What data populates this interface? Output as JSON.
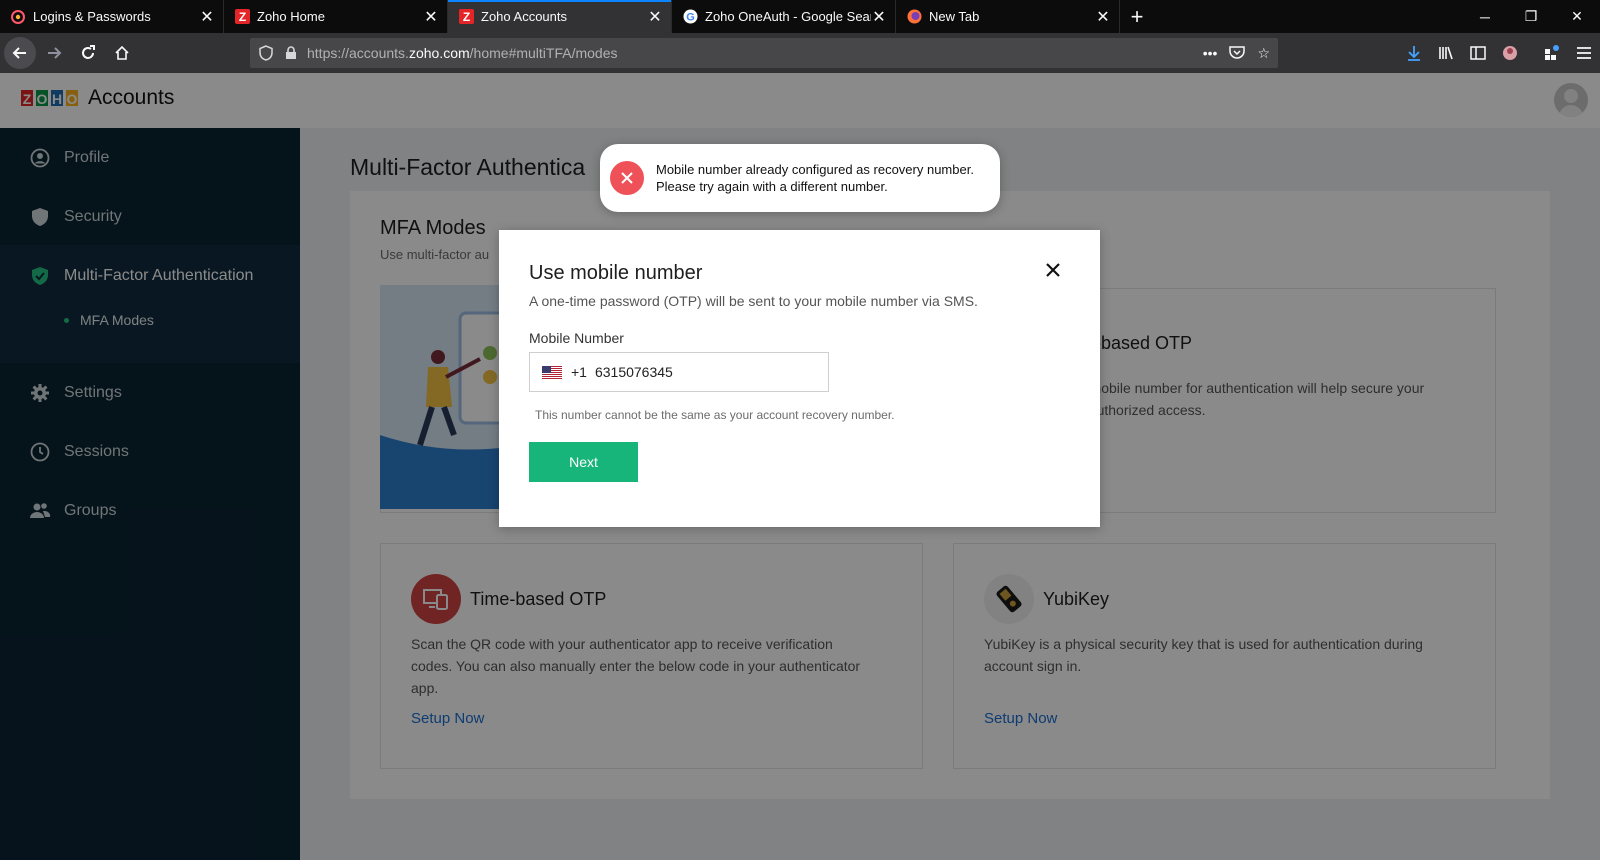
{
  "browser": {
    "tabs": [
      {
        "title": "Logins & Passwords",
        "icon": "lockwise-icon"
      },
      {
        "title": "Zoho Home",
        "icon": "zoho-icon"
      },
      {
        "title": "Zoho Accounts",
        "icon": "zoho-icon",
        "active": true
      },
      {
        "title": "Zoho OneAuth - Google Search",
        "icon": "google-icon"
      },
      {
        "title": "New Tab",
        "icon": "firefox-icon"
      }
    ],
    "url_prefix": "https://accounts.",
    "url_domain": "zoho.com",
    "url_path": "/home#multiTFA/modes"
  },
  "app": {
    "logo_letters": [
      "Z",
      "O",
      "H",
      "O"
    ],
    "name": "Accounts"
  },
  "sidebar": {
    "items": [
      {
        "label": "Profile",
        "icon": "profile-icon"
      },
      {
        "label": "Security",
        "icon": "shield-icon"
      },
      {
        "label": "Multi-Factor Authentication",
        "icon": "shield-check-icon"
      },
      {
        "label": "Settings",
        "icon": "gear-icon"
      },
      {
        "label": "Sessions",
        "icon": "clock-icon"
      },
      {
        "label": "Groups",
        "icon": "groups-icon"
      }
    ],
    "sub_item": "MFA Modes"
  },
  "main": {
    "page_title": "Multi-Factor Authentica",
    "section_title": "MFA Modes",
    "section_sub": "Use multi-factor au",
    "sms_card": {
      "title_partial": "le-based OTP",
      "desc_line1": "r mobile number for authentication will help secure your",
      "desc_line2": "nauthorized access."
    },
    "totp_card": {
      "title": "Time-based OTP",
      "desc_line1": "Scan the QR code with your authenticator app to receive verification",
      "desc_line2": "codes. You can also manually enter the below code in your authenticator",
      "desc_line3": "app.",
      "link": "Setup Now"
    },
    "yubikey_card": {
      "title": "YubiKey",
      "desc_line1": "YubiKey is a physical security key that is used for authentication during",
      "desc_line2": "account sign in.",
      "link": "Setup Now"
    }
  },
  "modal": {
    "title": "Use mobile number",
    "description": "A one-time password (OTP) will be sent to your mobile number via SMS.",
    "field_label": "Mobile Number",
    "country_code": "+1",
    "phone_value": "6315076345",
    "hint": "This number cannot be the same as your account recovery number.",
    "next_label": "Next"
  },
  "toast": {
    "line1": "Mobile number already configured as recovery number.",
    "line2": "Please try again with a different number.",
    "color": "#ee5157"
  }
}
